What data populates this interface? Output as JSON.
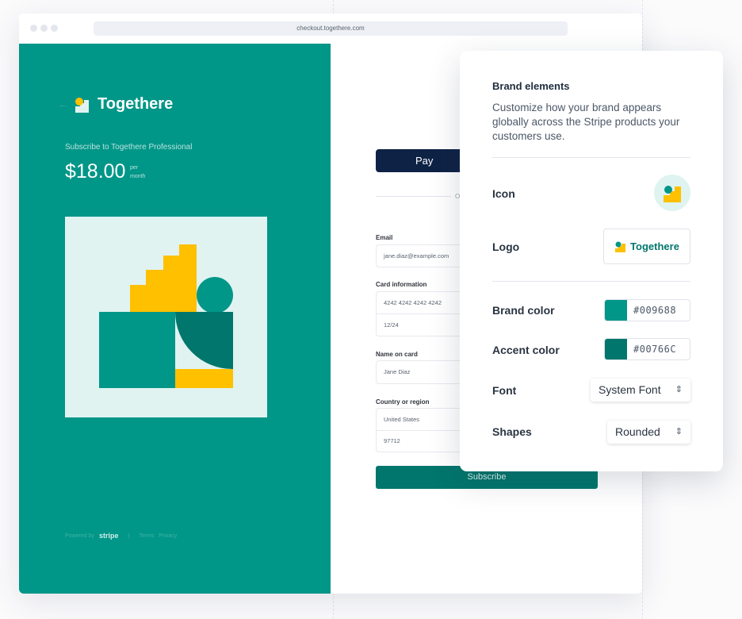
{
  "browser": {
    "url": "checkout.togethere.com"
  },
  "checkout": {
    "brand_name": "Togethere",
    "subtitle": "Subscribe to Togethere Professional",
    "price": "$18.00",
    "per": "per",
    "month": "month",
    "footer": {
      "powered_by": "Powered by",
      "stripe": "stripe",
      "terms": "Terms",
      "privacy": "Privacy"
    },
    "apple_pay": "Pay",
    "or": "O",
    "email_label": "Email",
    "email_value": "jane.diaz@example.com",
    "card_label": "Card information",
    "card_number": "4242 4242 4242 4242",
    "card_expiry": "12/24",
    "name_label": "Name on card",
    "name_value": "Jane Diaz",
    "country_label": "Country or region",
    "country_value": "United States",
    "zip_value": "97712",
    "subscribe": "Subscribe"
  },
  "panel": {
    "title": "Brand elements",
    "description": "Customize how your brand appears globally across the Stripe products your customers use.",
    "icon_label": "Icon",
    "logo_label": "Logo",
    "logo_text": "Togethere",
    "brand_color_label": "Brand color",
    "brand_color": "#009688",
    "accent_color_label": "Accent color",
    "accent_color": "#00766C",
    "font_label": "Font",
    "font_value": "System Font",
    "shapes_label": "Shapes",
    "shapes_value": "Rounded"
  },
  "colors": {
    "brand": "#009688",
    "accent": "#00766c",
    "yellow": "#ffc000"
  }
}
